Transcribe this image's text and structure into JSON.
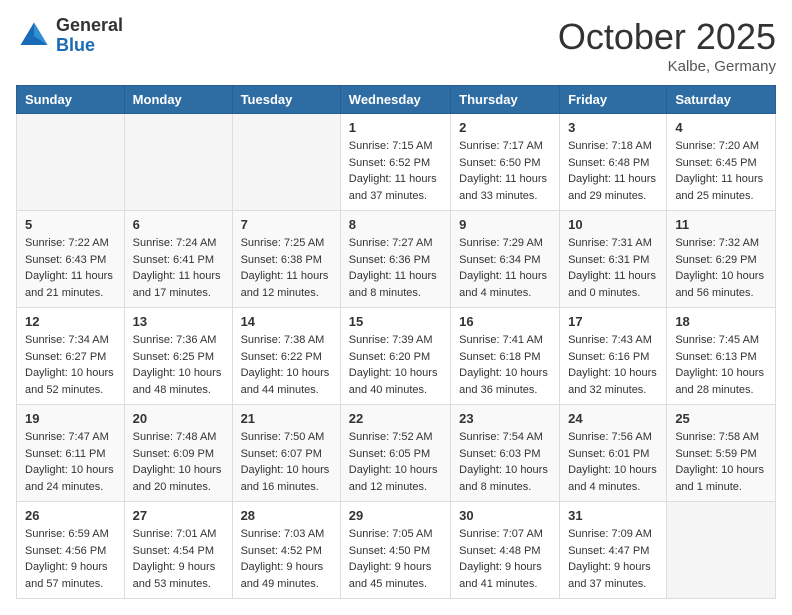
{
  "logo": {
    "general": "General",
    "blue": "Blue"
  },
  "header": {
    "month": "October 2025",
    "location": "Kalbe, Germany"
  },
  "weekdays": [
    "Sunday",
    "Monday",
    "Tuesday",
    "Wednesday",
    "Thursday",
    "Friday",
    "Saturday"
  ],
  "weeks": [
    [
      {
        "day": "",
        "info": ""
      },
      {
        "day": "",
        "info": ""
      },
      {
        "day": "",
        "info": ""
      },
      {
        "day": "1",
        "sunrise": "7:15 AM",
        "sunset": "6:52 PM",
        "daylight": "11 hours and 37 minutes."
      },
      {
        "day": "2",
        "sunrise": "7:17 AM",
        "sunset": "6:50 PM",
        "daylight": "11 hours and 33 minutes."
      },
      {
        "day": "3",
        "sunrise": "7:18 AM",
        "sunset": "6:48 PM",
        "daylight": "11 hours and 29 minutes."
      },
      {
        "day": "4",
        "sunrise": "7:20 AM",
        "sunset": "6:45 PM",
        "daylight": "11 hours and 25 minutes."
      }
    ],
    [
      {
        "day": "5",
        "sunrise": "7:22 AM",
        "sunset": "6:43 PM",
        "daylight": "11 hours and 21 minutes."
      },
      {
        "day": "6",
        "sunrise": "7:24 AM",
        "sunset": "6:41 PM",
        "daylight": "11 hours and 17 minutes."
      },
      {
        "day": "7",
        "sunrise": "7:25 AM",
        "sunset": "6:38 PM",
        "daylight": "11 hours and 12 minutes."
      },
      {
        "day": "8",
        "sunrise": "7:27 AM",
        "sunset": "6:36 PM",
        "daylight": "11 hours and 8 minutes."
      },
      {
        "day": "9",
        "sunrise": "7:29 AM",
        "sunset": "6:34 PM",
        "daylight": "11 hours and 4 minutes."
      },
      {
        "day": "10",
        "sunrise": "7:31 AM",
        "sunset": "6:31 PM",
        "daylight": "11 hours and 0 minutes."
      },
      {
        "day": "11",
        "sunrise": "7:32 AM",
        "sunset": "6:29 PM",
        "daylight": "10 hours and 56 minutes."
      }
    ],
    [
      {
        "day": "12",
        "sunrise": "7:34 AM",
        "sunset": "6:27 PM",
        "daylight": "10 hours and 52 minutes."
      },
      {
        "day": "13",
        "sunrise": "7:36 AM",
        "sunset": "6:25 PM",
        "daylight": "10 hours and 48 minutes."
      },
      {
        "day": "14",
        "sunrise": "7:38 AM",
        "sunset": "6:22 PM",
        "daylight": "10 hours and 44 minutes."
      },
      {
        "day": "15",
        "sunrise": "7:39 AM",
        "sunset": "6:20 PM",
        "daylight": "10 hours and 40 minutes."
      },
      {
        "day": "16",
        "sunrise": "7:41 AM",
        "sunset": "6:18 PM",
        "daylight": "10 hours and 36 minutes."
      },
      {
        "day": "17",
        "sunrise": "7:43 AM",
        "sunset": "6:16 PM",
        "daylight": "10 hours and 32 minutes."
      },
      {
        "day": "18",
        "sunrise": "7:45 AM",
        "sunset": "6:13 PM",
        "daylight": "10 hours and 28 minutes."
      }
    ],
    [
      {
        "day": "19",
        "sunrise": "7:47 AM",
        "sunset": "6:11 PM",
        "daylight": "10 hours and 24 minutes."
      },
      {
        "day": "20",
        "sunrise": "7:48 AM",
        "sunset": "6:09 PM",
        "daylight": "10 hours and 20 minutes."
      },
      {
        "day": "21",
        "sunrise": "7:50 AM",
        "sunset": "6:07 PM",
        "daylight": "10 hours and 16 minutes."
      },
      {
        "day": "22",
        "sunrise": "7:52 AM",
        "sunset": "6:05 PM",
        "daylight": "10 hours and 12 minutes."
      },
      {
        "day": "23",
        "sunrise": "7:54 AM",
        "sunset": "6:03 PM",
        "daylight": "10 hours and 8 minutes."
      },
      {
        "day": "24",
        "sunrise": "7:56 AM",
        "sunset": "6:01 PM",
        "daylight": "10 hours and 4 minutes."
      },
      {
        "day": "25",
        "sunrise": "7:58 AM",
        "sunset": "5:59 PM",
        "daylight": "10 hours and 1 minute."
      }
    ],
    [
      {
        "day": "26",
        "sunrise": "6:59 AM",
        "sunset": "4:56 PM",
        "daylight": "9 hours and 57 minutes."
      },
      {
        "day": "27",
        "sunrise": "7:01 AM",
        "sunset": "4:54 PM",
        "daylight": "9 hours and 53 minutes."
      },
      {
        "day": "28",
        "sunrise": "7:03 AM",
        "sunset": "4:52 PM",
        "daylight": "9 hours and 49 minutes."
      },
      {
        "day": "29",
        "sunrise": "7:05 AM",
        "sunset": "4:50 PM",
        "daylight": "9 hours and 45 minutes."
      },
      {
        "day": "30",
        "sunrise": "7:07 AM",
        "sunset": "4:48 PM",
        "daylight": "9 hours and 41 minutes."
      },
      {
        "day": "31",
        "sunrise": "7:09 AM",
        "sunset": "4:47 PM",
        "daylight": "9 hours and 37 minutes."
      },
      {
        "day": "",
        "info": ""
      }
    ]
  ]
}
